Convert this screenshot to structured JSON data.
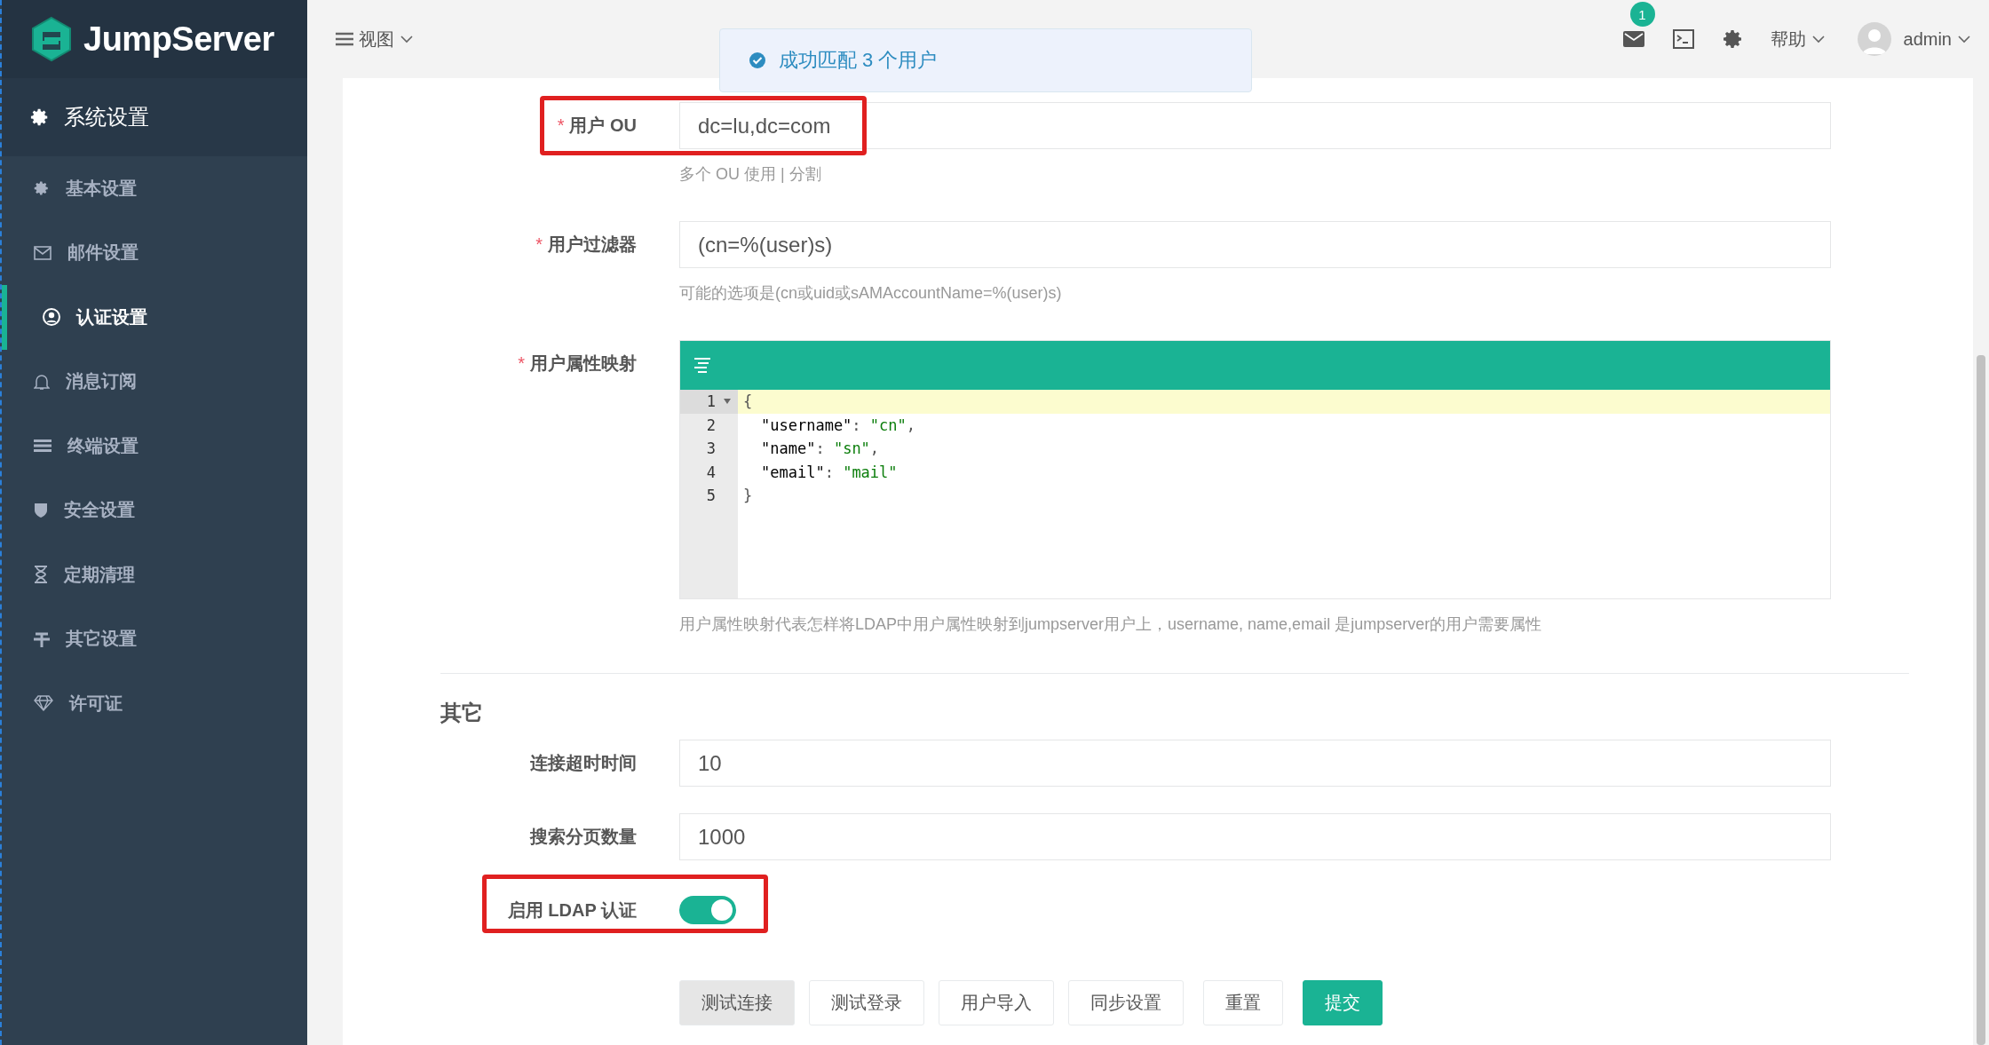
{
  "sidebar": {
    "logo": "JumpServer",
    "section": "系统设置",
    "items": [
      {
        "label": "基本设置",
        "selected": false
      },
      {
        "label": "邮件设置",
        "selected": false
      },
      {
        "label": "认证设置",
        "selected": true
      },
      {
        "label": "消息订阅",
        "selected": false
      },
      {
        "label": "终端设置",
        "selected": false
      },
      {
        "label": "安全设置",
        "selected": false
      },
      {
        "label": "定期清理",
        "selected": false
      },
      {
        "label": "其它设置",
        "selected": false
      },
      {
        "label": "许可证",
        "selected": false
      }
    ]
  },
  "header": {
    "view_menu": "视图",
    "notification_count": "1",
    "help_menu": "帮助",
    "user": "admin"
  },
  "toast": {
    "message": "成功匹配 3 个用户"
  },
  "form": {
    "fields": [
      {
        "kind": "input",
        "label": "用户 OU",
        "required_mark": "*",
        "highlighted": true,
        "value": "dc=lu,dc=com",
        "help": "多个 OU 使用 | 分割"
      },
      {
        "kind": "input",
        "label": "用户过滤器",
        "required_mark": "*",
        "highlighted": false,
        "value": "(cn=%(user)s)",
        "help": "可能的选项是(cn或uid或sAMAccountName=%(user)s)"
      },
      {
        "kind": "code",
        "label": "用户属性映射",
        "required_mark": "*",
        "highlighted": false,
        "help": "用户属性映射代表怎样将LDAP中用户属性映射到jumpserver用户上，username, name,email 是jumpserver的用户需要属性",
        "lines": [
          {
            "number": "1",
            "active": true,
            "tokens": [
              {
                "kind": "punct",
                "text": "{"
              }
            ]
          },
          {
            "number": "2",
            "active": false,
            "indented": true,
            "tokens": [
              {
                "kind": "key",
                "text": "\"username\""
              },
              {
                "kind": "punct",
                "text": ": "
              },
              {
                "kind": "string",
                "text": "\"cn\""
              },
              {
                "kind": "punct",
                "text": ","
              }
            ]
          },
          {
            "number": "3",
            "active": false,
            "indented": true,
            "tokens": [
              {
                "kind": "key",
                "text": "\"name\""
              },
              {
                "kind": "punct",
                "text": ": "
              },
              {
                "kind": "string",
                "text": "\"sn\""
              },
              {
                "kind": "punct",
                "text": ","
              }
            ]
          },
          {
            "number": "4",
            "active": false,
            "indented": true,
            "tokens": [
              {
                "kind": "key",
                "text": "\"email\""
              },
              {
                "kind": "punct",
                "text": ": "
              },
              {
                "kind": "string",
                "text": "\"mail\""
              }
            ]
          },
          {
            "number": "5",
            "active": false,
            "tokens": [
              {
                "kind": "punct",
                "text": "}"
              }
            ]
          }
        ]
      }
    ],
    "section": {
      "title": "其它",
      "fields": [
        {
          "kind": "input",
          "label": "连接超时时间",
          "highlighted": false,
          "value": "10"
        },
        {
          "kind": "input",
          "label": "搜索分页数量",
          "highlighted": false,
          "value": "1000"
        },
        {
          "kind": "switch",
          "label": "启用 LDAP 认证",
          "highlighted": true,
          "on": true
        }
      ]
    },
    "buttons": [
      {
        "label": "测试连接",
        "kind": "pressed"
      },
      {
        "label": "测试登录",
        "kind": "default"
      },
      {
        "label": "用户导入",
        "kind": "default"
      },
      {
        "label": "同步设置",
        "kind": "default"
      },
      {
        "label": "重置",
        "kind": "default"
      },
      {
        "label": "提交",
        "kind": "primary"
      }
    ]
  }
}
